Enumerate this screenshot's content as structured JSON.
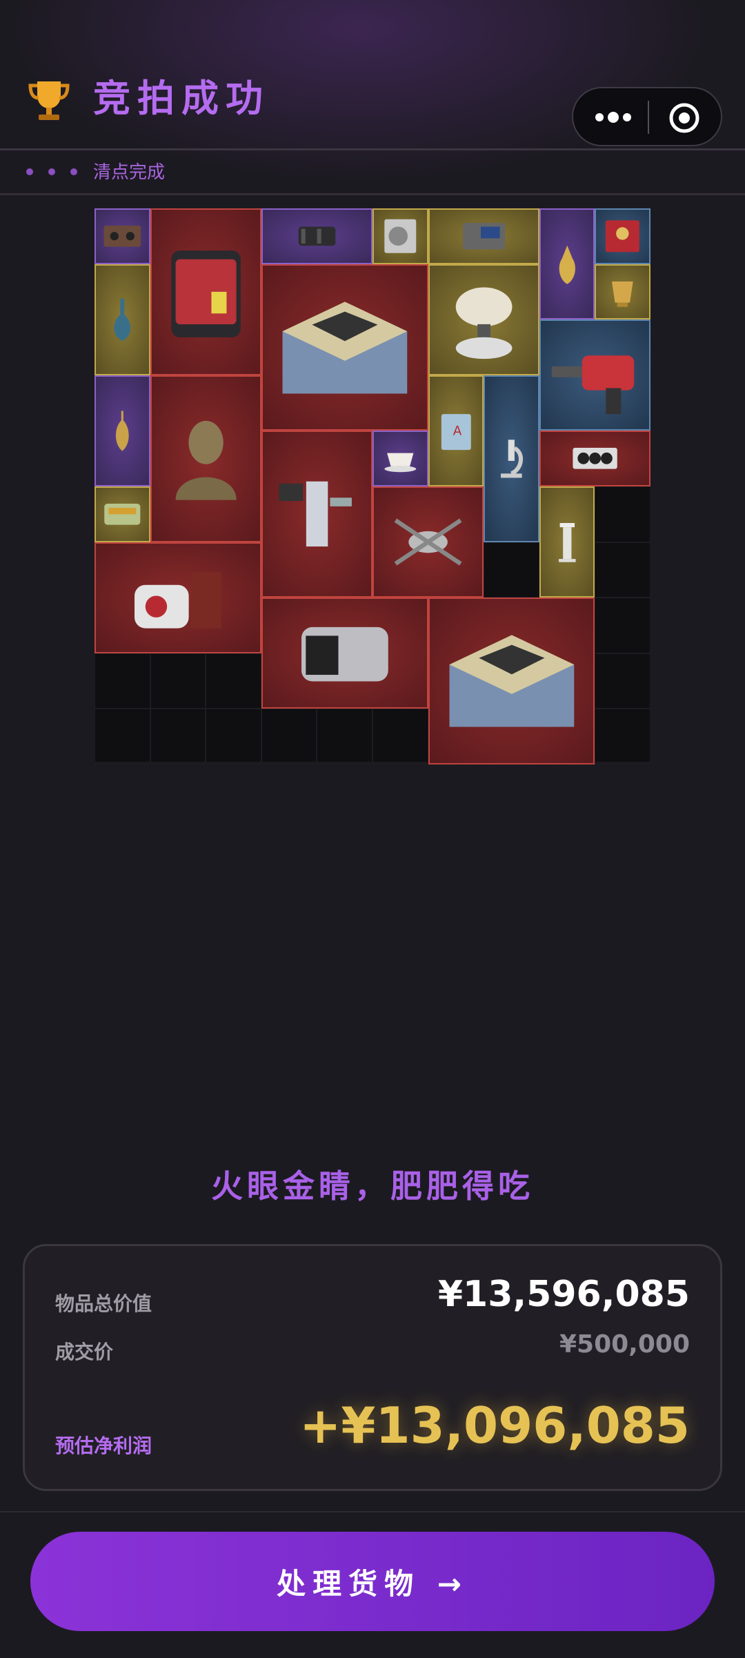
{
  "header": {
    "title": "竞拍成功",
    "trophy_icon": "trophy-icon",
    "capsule_more_icon": "more-dots-icon",
    "capsule_close_icon": "target-close-icon"
  },
  "status": {
    "label": "清点完成",
    "dot_count": 3
  },
  "inventory": {
    "columns": 10,
    "rows": 10,
    "items": [
      {
        "name": "cassette-tape",
        "rarity": "purple"
      },
      {
        "name": "aed-defibrillator",
        "rarity": "red"
      },
      {
        "name": "camera-lens",
        "rarity": "purple"
      },
      {
        "name": "hard-drive",
        "rarity": "gold"
      },
      {
        "name": "circuit-board",
        "rarity": "gold"
      },
      {
        "name": "golden-ewer",
        "rarity": "purple"
      },
      {
        "name": "royal-tin",
        "rarity": "blue"
      },
      {
        "name": "blue-glass-vase",
        "rarity": "gold"
      },
      {
        "name": "chess-box",
        "rarity": "red"
      },
      {
        "name": "wafer-stand",
        "rarity": "gold"
      },
      {
        "name": "golden-cup",
        "rarity": "gold"
      },
      {
        "name": "rotary-hammer",
        "rarity": "blue"
      },
      {
        "name": "ornate-ewer",
        "rarity": "purple"
      },
      {
        "name": "bronze-bust",
        "rarity": "red"
      },
      {
        "name": "surgical-robot",
        "rarity": "red"
      },
      {
        "name": "teacup",
        "rarity": "purple"
      },
      {
        "name": "book",
        "rarity": "gold"
      },
      {
        "name": "microscope",
        "rarity": "blue"
      },
      {
        "name": "graphics-card",
        "rarity": "red"
      },
      {
        "name": "drone",
        "rarity": "red"
      },
      {
        "name": "mint-tin",
        "rarity": "gold"
      },
      {
        "name": "marble-column",
        "rarity": "gold"
      },
      {
        "name": "flight-recorder",
        "rarity": "red"
      },
      {
        "name": "server-unit",
        "rarity": "red"
      },
      {
        "name": "chess-box-2",
        "rarity": "red"
      }
    ]
  },
  "slogan": "火眼金睛，肥肥得吃",
  "summary": {
    "total_value_label": "物品总价值",
    "total_value": "¥13,596,085",
    "deal_price_label": "成交价",
    "deal_price": "¥500,000",
    "profit_label": "预估净利润",
    "profit": "+¥13,096,085"
  },
  "action": {
    "button_label": "处理货物 →"
  },
  "colors": {
    "accent_purple": "#b56cf0",
    "profit_gold": "#e6c255",
    "background": "#1c1a21",
    "rarity_red": "#c0443f",
    "rarity_gold": "#c2a94b",
    "rarity_purple": "#8c62c8",
    "rarity_blue": "#5d86b0"
  }
}
